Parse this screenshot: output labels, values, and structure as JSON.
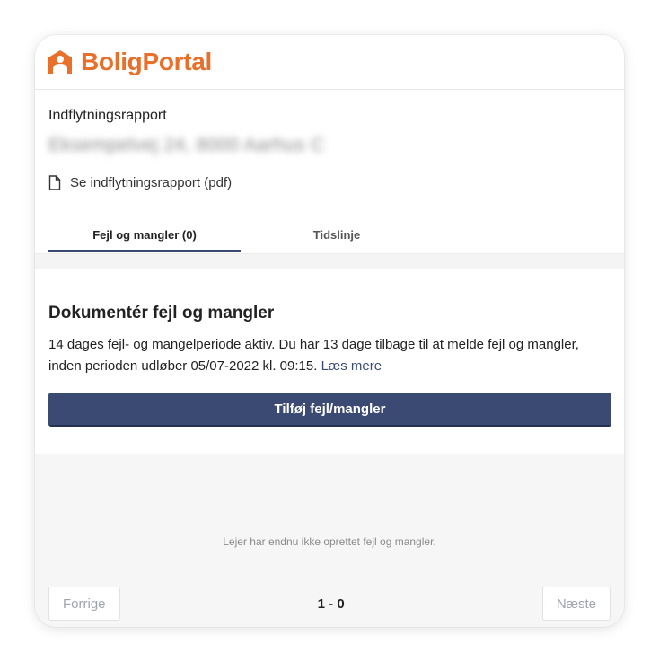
{
  "brand": {
    "name": "BoligPortal",
    "color": "#e8702a",
    "logo_icon": "house-person-icon"
  },
  "report": {
    "title": "Indflytningsrapport",
    "address": "Eksempelvej 24, 8000 Aarhus C",
    "pdf_link": "Se indflytningsrapport (pdf)",
    "pdf_icon": "document-icon"
  },
  "tabs": [
    {
      "label": "Fejl og mangler (0)",
      "active": true
    },
    {
      "label": "Tidslinje",
      "active": false
    }
  ],
  "document": {
    "title": "Dokumentér fejl og mangler",
    "description": "14 dages fejl- og mangelperiode aktiv. Du har 13 dage tilbage til at melde fejl og mangler, inden perioden udløber 05/07-2022 kl. 09:15.",
    "read_more": "Læs mere",
    "add_button": "Tilføj fejl/mangler",
    "button_color": "#3b4a72"
  },
  "empty_state": "Lejer har endnu ikke oprettet fejl og mangler.",
  "pagination": {
    "prev": "Forrige",
    "next": "Næste",
    "range": "1 - 0"
  }
}
